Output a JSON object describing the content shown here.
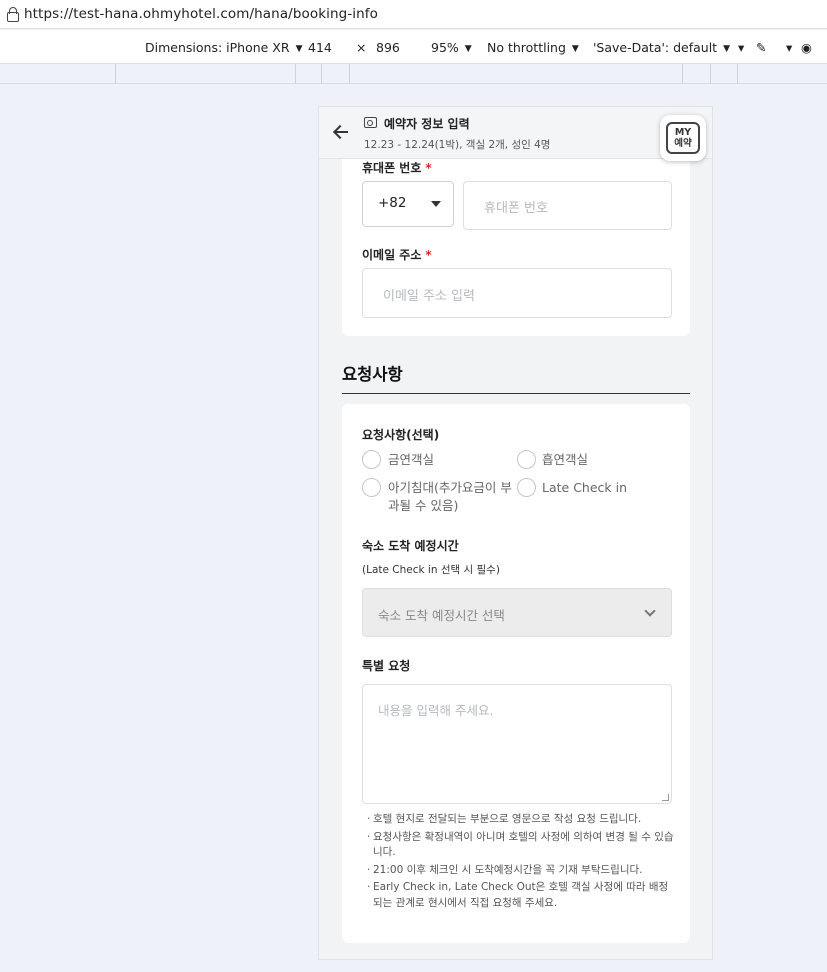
{
  "browser": {
    "url": "https://test-hana.ohmyhotel.com/hana/booking-info"
  },
  "devtools": {
    "dimensions_label": "Dimensions: iPhone XR",
    "width": "414",
    "times": "×",
    "height": "896",
    "zoom": "95%",
    "throttling": "No throttling",
    "save_data": "'Save-Data': default"
  },
  "header": {
    "title": "예약자 정보 입력",
    "subtitle": "12.23 - 12.24(1박), 객실 2개, 성인 4명",
    "my_line1": "MY",
    "my_line2": "예약"
  },
  "contact": {
    "phone_label": "휴대폰 번호",
    "required_mark": "*",
    "country_code": "+82",
    "phone_placeholder": "휴대폰 번호",
    "email_label": "이메일 주소",
    "email_placeholder": "이메일 주소 입력"
  },
  "requests": {
    "section_title": "요청사항",
    "options_label": "요청사항(선택)",
    "options": [
      {
        "label": "금연객실"
      },
      {
        "label": "흡연객실"
      },
      {
        "label": "아기침대(추가요금이 부과될 수 있음)"
      },
      {
        "label": "Late Check in"
      }
    ],
    "arrival_label": "숙소 도착 예정시간",
    "arrival_note": "(Late Check in 선택 시 필수)",
    "arrival_placeholder": "숙소 도착 예정시간 선택",
    "special_label": "특별 요청",
    "special_placeholder": "내용을 입력해 주세요.",
    "notes": [
      "호텔 현지로 전달되는 부분으로 영문으로 작성 요청 드립니다.",
      "요청사항은 확정내역이 아니며 호텔의 사정에 의하여 변경 될 수 있습니다.",
      "21:00 이후 체크인 시 도착예정시간을 꼭 기재 부탁드립니다.",
      "Early Check in, Late Check Out은 호텔 객실 사정에 따라 배정되는 관계로 현시에서 직접 요청해 주세요."
    ]
  }
}
